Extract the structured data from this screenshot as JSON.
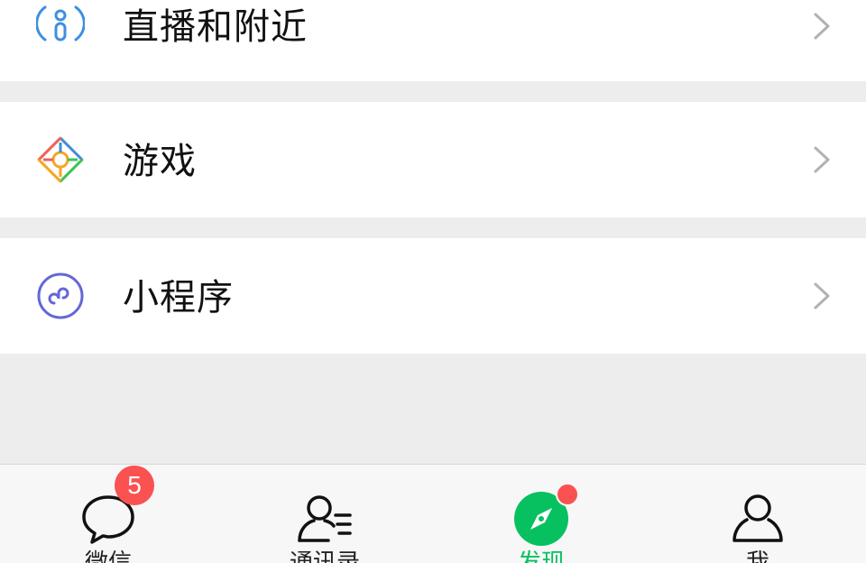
{
  "list": {
    "items": [
      {
        "label": "直播和附近",
        "icon": "live-nearby-icon"
      },
      {
        "label": "游戏",
        "icon": "games-icon"
      },
      {
        "label": "小程序",
        "icon": "mini-programs-icon"
      }
    ]
  },
  "tabbar": {
    "tabs": [
      {
        "label": "微信",
        "icon": "chat-bubble-icon",
        "badge": "5"
      },
      {
        "label": "通讯录",
        "icon": "contacts-icon"
      },
      {
        "label": "发现",
        "icon": "compass-icon",
        "active": true
      },
      {
        "label": "我",
        "icon": "person-icon"
      }
    ]
  },
  "colors": {
    "accent": "#07c160",
    "badge": "#fa5151",
    "background": "#ededed"
  }
}
